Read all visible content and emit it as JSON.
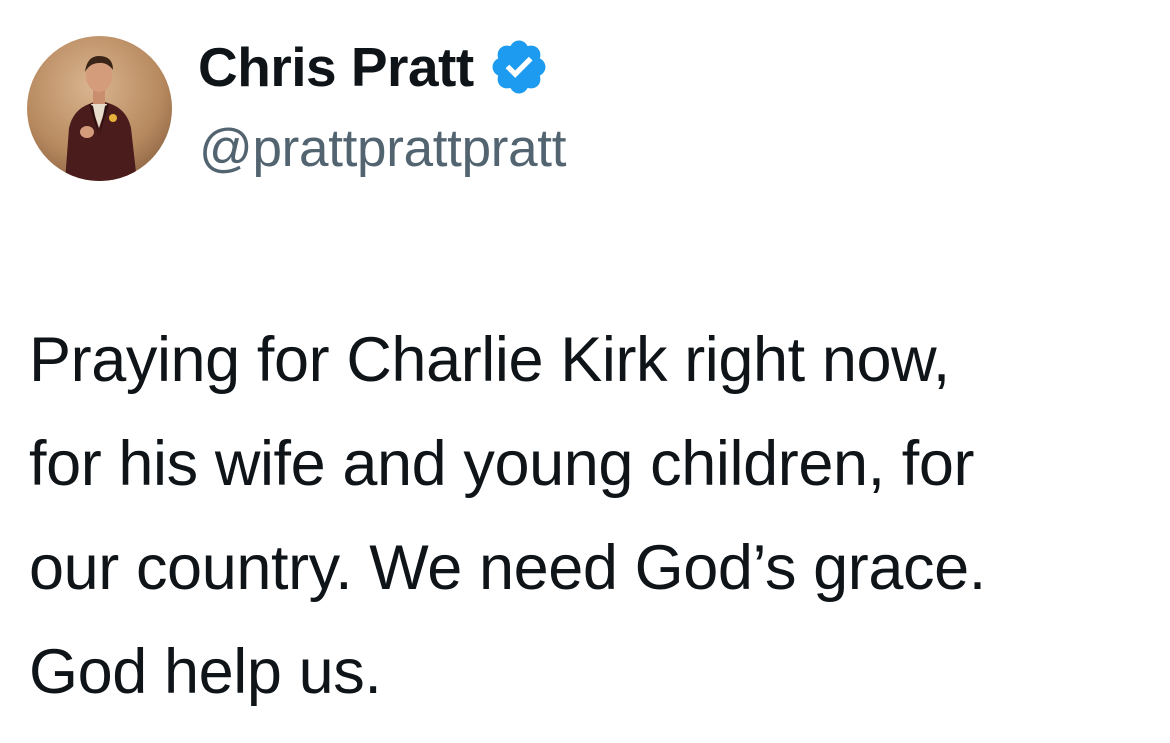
{
  "author": {
    "display_name": "Chris Pratt",
    "handle": "@prattprattpratt",
    "verified": true,
    "verified_badge_color": "#1d9bf0",
    "avatar_icon": "profile-photo"
  },
  "tweet": {
    "lines": [
      "Praying for Charlie Kirk right now,",
      "for his wife and young children, for",
      "our country. We need God’s grace.",
      "God help us."
    ]
  },
  "colors": {
    "name": "#0f1419",
    "handle": "#536471",
    "body": "#0f1419",
    "background": "#ffffff"
  }
}
